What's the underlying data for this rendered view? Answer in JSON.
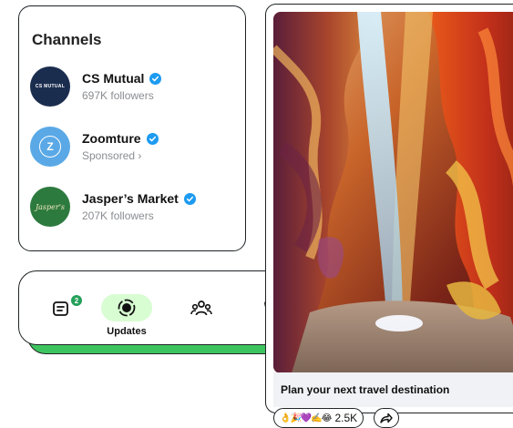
{
  "channels": {
    "title": "Channels",
    "items": [
      {
        "name": "CS Mutual",
        "subtitle": "697K followers",
        "avatar_text": "CS MUTUAL",
        "verified": true
      },
      {
        "name": "Zoomture",
        "subtitle": "Sponsored ›",
        "avatar_text": "Z",
        "verified": true
      },
      {
        "name": "Jasper’s Market",
        "subtitle": "207K followers",
        "avatar_text": "Jasper's",
        "verified": true
      }
    ]
  },
  "nav": {
    "items": [
      {
        "icon": "chats-icon",
        "badge": "2"
      },
      {
        "icon": "updates-icon",
        "label": "Updates",
        "active": true
      },
      {
        "icon": "communities-icon"
      },
      {
        "icon": "calls-icon"
      }
    ]
  },
  "post": {
    "caption": "Plan your next travel destination",
    "reactions_emojis": "👌🎉💜✍️😂",
    "reactions_count": "2.5K",
    "share_icon": "forward-icon"
  },
  "colors": {
    "accent_green": "#3ec45f",
    "active_pill": "#d8fdd2",
    "verified_blue": "#1d9bf0"
  }
}
